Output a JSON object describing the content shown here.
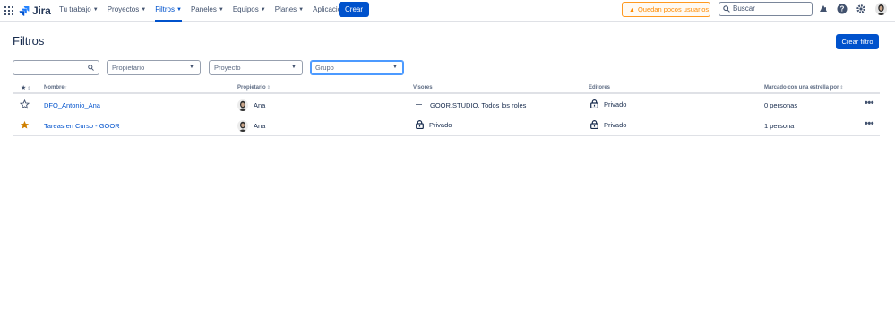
{
  "nav": {
    "logo": "Jira",
    "items": [
      {
        "label": "Tu trabajo"
      },
      {
        "label": "Proyectos"
      },
      {
        "label": "Filtros"
      },
      {
        "label": "Paneles"
      },
      {
        "label": "Equipos"
      },
      {
        "label": "Planes"
      },
      {
        "label": "Aplicaciones"
      }
    ],
    "create": "Crear",
    "warning": "Quedan pocos usuarios",
    "search_placeholder": "Buscar"
  },
  "page": {
    "title": "Filtros",
    "create_filter": "Crear filtro"
  },
  "filters": {
    "search_value": "",
    "owner_placeholder": "Propietario",
    "project_placeholder": "Proyecto",
    "group_placeholder": "Grupo"
  },
  "table": {
    "headers": {
      "star": "★",
      "name": "Nombre",
      "owner": "Propietario",
      "viewers": "Visores",
      "editors": "Editores",
      "starred_by": "Marcado con una estrella por"
    },
    "rows": [
      {
        "starred": false,
        "name": "DFO_Antonio_Ana",
        "owner": "Ana",
        "viewers": "GOOR.STUDIO. Todos los roles",
        "editors": "Privado",
        "starred_by": "0 personas"
      },
      {
        "starred": true,
        "name": "Tareas en Curso - GOOR",
        "owner": "Ana",
        "viewers": "Privado",
        "editors": "Privado",
        "starred_by": "1 persona"
      }
    ]
  },
  "colors": {
    "accent": "#0052cc",
    "warning": "#ff8b00",
    "star": "#cf7f00"
  }
}
